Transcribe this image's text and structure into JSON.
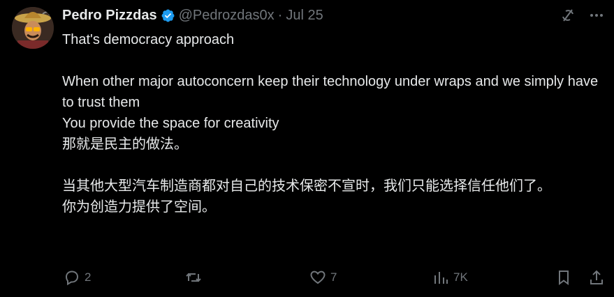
{
  "author": {
    "name": "Pedro Pizzdas",
    "handle": "@Pedrozdas0x",
    "separator": "·",
    "date": "Jul 25"
  },
  "tweet": {
    "en_line1": "That's democracy approach",
    "en_line2": "When other major autoconcern keep their technology under wraps and we simply have to trust them",
    "en_line3": "You provide the space for creativity",
    "cn_line1": "那就是民主的做法。",
    "cn_line2": "当其他大型汽车制造商都对自己的技术保密不宣时，我们只能选择信任他们了。",
    "cn_line3": "你为创造力提供了空间。"
  },
  "actions": {
    "replies": "2",
    "reposts": "",
    "likes": "7",
    "views": "7K"
  },
  "colors": {
    "background": "#000000",
    "text": "#e7e9ea",
    "muted": "#71767b",
    "verified": "#1d9bf0"
  },
  "icons": [
    "avatar",
    "verified-badge-icon",
    "grok-icon",
    "more-icon",
    "reply-icon",
    "repost-icon",
    "like-icon",
    "views-icon",
    "bookmark-icon",
    "share-icon"
  ]
}
